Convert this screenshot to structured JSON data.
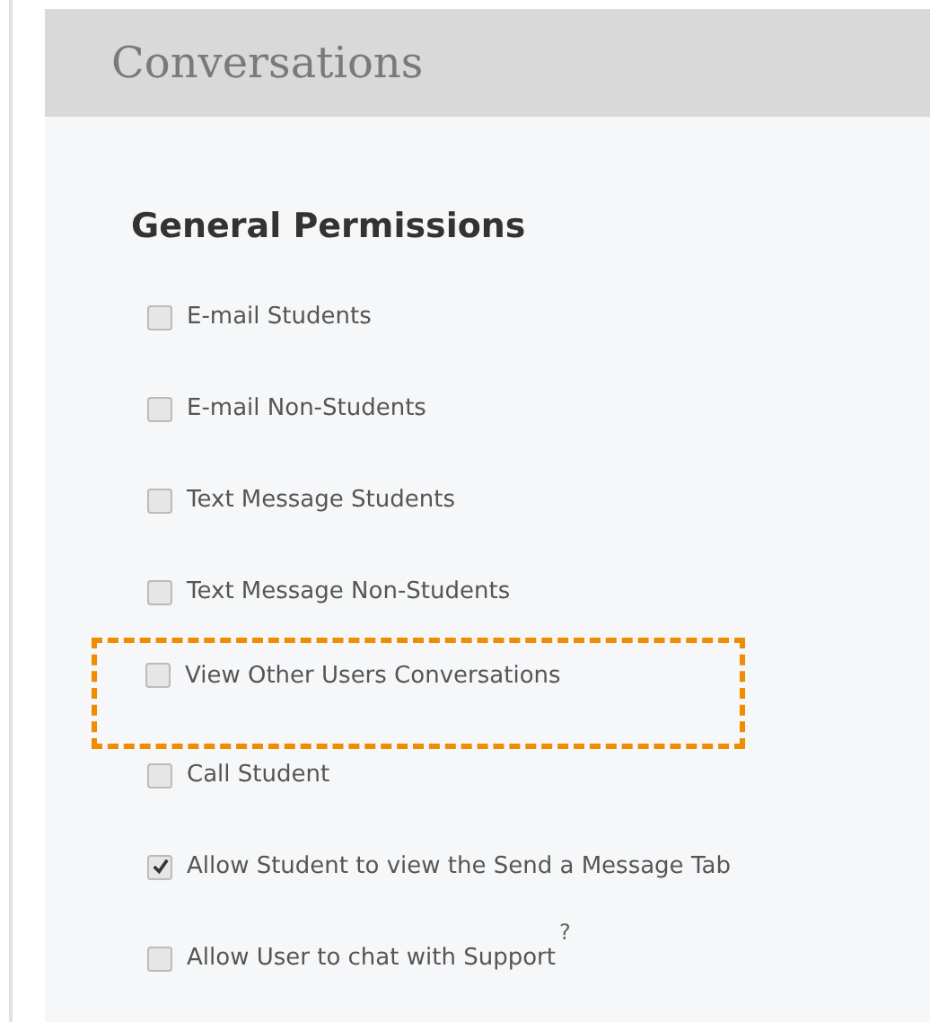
{
  "panel": {
    "title": "Conversations"
  },
  "section": {
    "heading": "General Permissions",
    "items": [
      {
        "label": "E-mail Students",
        "checked": false,
        "highlighted": false
      },
      {
        "label": "E-mail Non-Students",
        "checked": false,
        "highlighted": false
      },
      {
        "label": "Text Message Students",
        "checked": false,
        "highlighted": false
      },
      {
        "label": "Text Message Non-Students",
        "checked": false,
        "highlighted": false
      },
      {
        "label": "View Other Users Conversations",
        "checked": false,
        "highlighted": true
      },
      {
        "label": "Call Student",
        "checked": false,
        "highlighted": false
      },
      {
        "label": "Allow Student to view the Send a Message Tab",
        "checked": true,
        "highlighted": false
      },
      {
        "label": "Allow User to chat with Support",
        "checked": false,
        "highlighted": false,
        "help": "?"
      }
    ]
  }
}
